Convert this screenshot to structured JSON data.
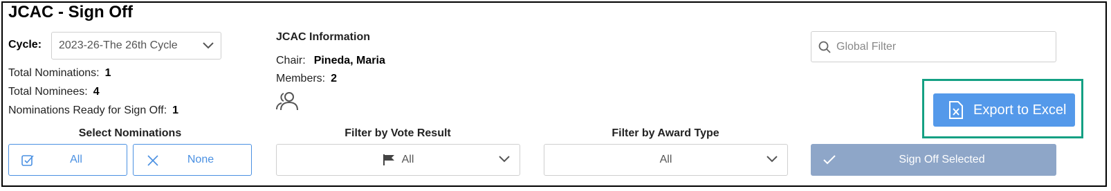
{
  "header": {
    "title": "JCAC - Sign Off"
  },
  "cycle": {
    "label": "Cycle:",
    "selected": "2023-26-The 26th Cycle"
  },
  "stats": [
    {
      "label": "Total Nominations:",
      "value": "1"
    },
    {
      "label": "Total Nominees:",
      "value": "4"
    },
    {
      "label": "Nominations Ready for Sign Off:",
      "value": "1"
    }
  ],
  "jcac_info": {
    "title": "JCAC Information",
    "chair_label": "Chair:",
    "chair_value": "Pineda, Maria",
    "members_label": "Members:",
    "members_value": "2",
    "members_icon": "people-group-icon"
  },
  "global_filter": {
    "placeholder": "Global Filter",
    "icon": "search-icon"
  },
  "export": {
    "label": "Export to Excel",
    "icon": "excel-file-icon",
    "outline_color": "#14a083",
    "bg_color": "#5499ea"
  },
  "select_nominations": {
    "title": "Select Nominations",
    "all_label": "All",
    "none_label": "None"
  },
  "vote_filter": {
    "title": "Filter by Vote Result",
    "selected": "All",
    "icon": "flag-icon"
  },
  "award_filter": {
    "title": "Filter by Award Type",
    "selected": "All"
  },
  "signoff": {
    "label": "Sign Off Selected",
    "icon": "check-icon",
    "bg_color": "#8ea6c8"
  }
}
